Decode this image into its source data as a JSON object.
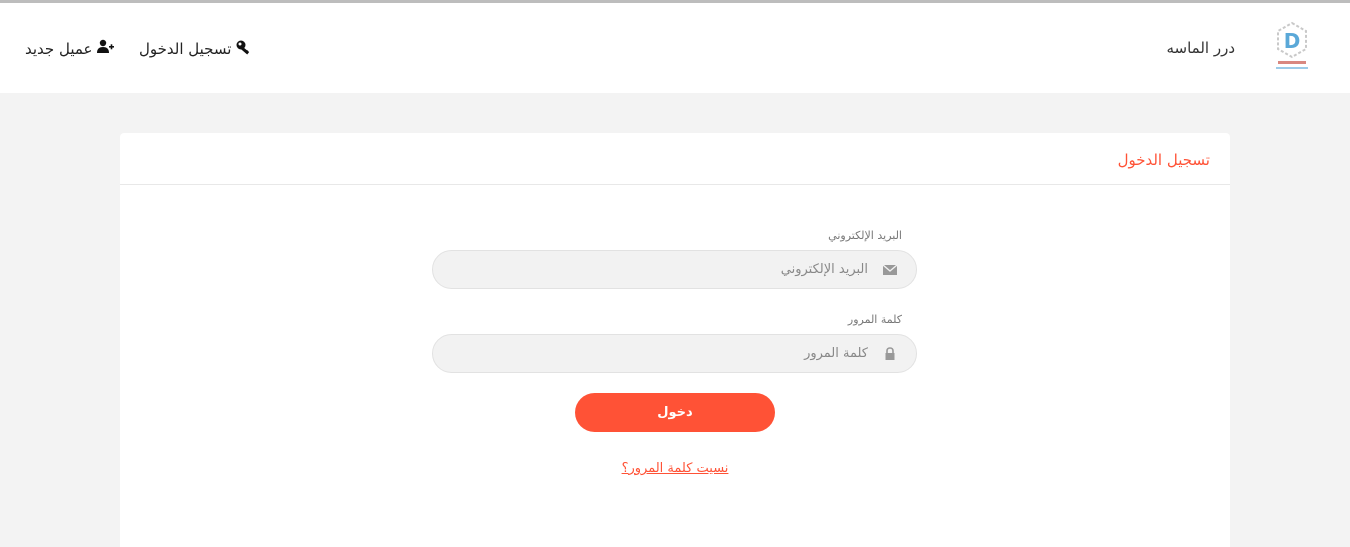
{
  "header": {
    "brand": "درر الماسه",
    "nav": {
      "login": "تسجيل الدخول",
      "register": "عميل جديد"
    }
  },
  "login": {
    "title": "تسجيل الدخول",
    "email_label": "البريد الإلكتروني",
    "email_placeholder": "البريد الإلكتروني",
    "password_label": "كلمة المرور",
    "password_placeholder": "كلمة المرور",
    "submit": "دخول",
    "forgot": "نسيت كلمة المرور؟"
  },
  "colors": {
    "accent": "#ff5236",
    "background": "#f3f3f3"
  },
  "icons": [
    "logo-icon",
    "key-icon",
    "add-user-icon",
    "envelope-icon",
    "lock-icon"
  ]
}
